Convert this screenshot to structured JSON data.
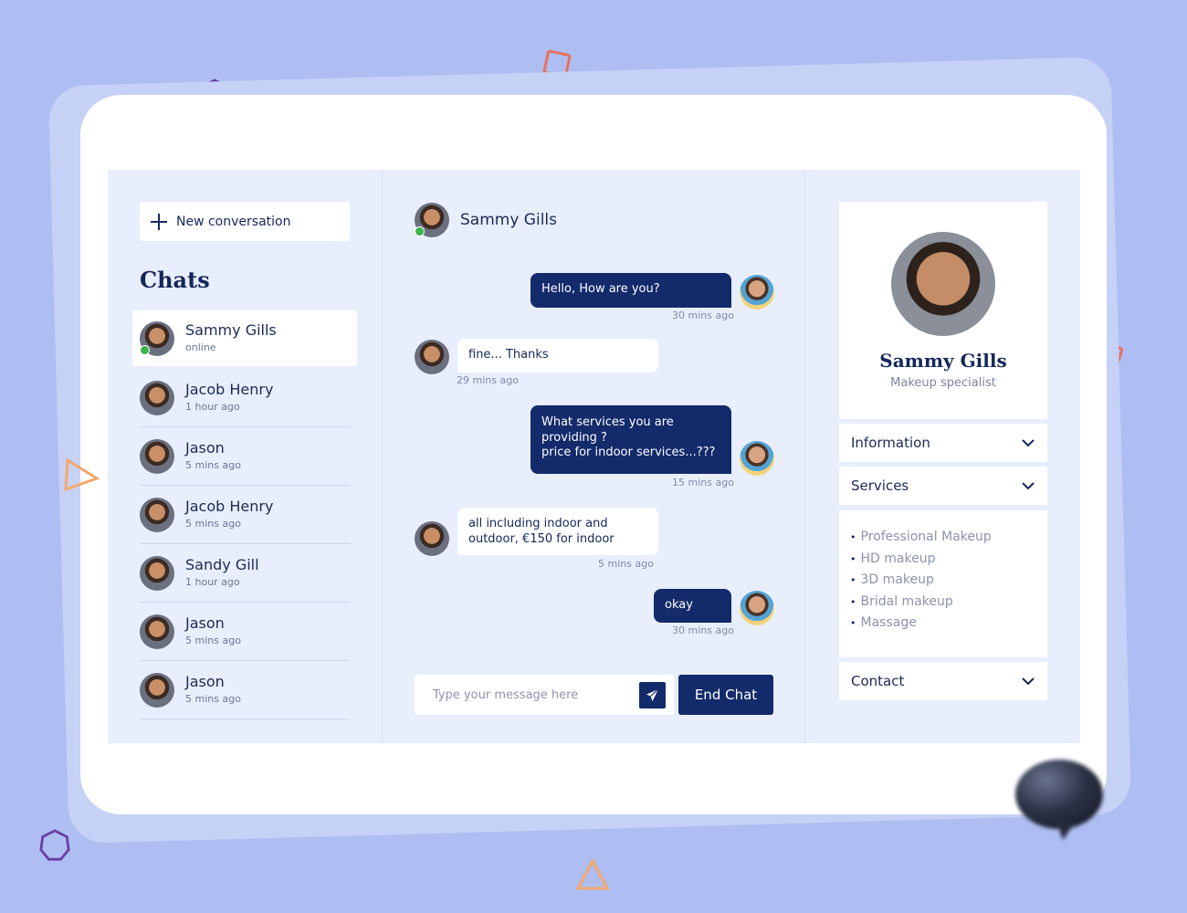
{
  "sidebar": {
    "new_conversation_label": "New conversation",
    "chats_title": "Chats",
    "chats": [
      {
        "name": "Sammy Gills",
        "status": "online",
        "active": true
      },
      {
        "name": "Jacob Henry",
        "status": "1 hour ago"
      },
      {
        "name": "Jason",
        "status": "5 mins ago"
      },
      {
        "name": "Jacob Henry",
        "status": "5 mins ago"
      },
      {
        "name": "Sandy Gill",
        "status": "1 hour ago"
      },
      {
        "name": "Jason",
        "status": "5 mins ago"
      },
      {
        "name": "Jason",
        "status": "5 mins ago"
      }
    ]
  },
  "chat": {
    "contact_name": "Sammy Gills",
    "messages": [
      {
        "direction": "out",
        "text": "Hello, How are you?",
        "time": "30 mins ago"
      },
      {
        "direction": "in",
        "text": "fine... Thanks",
        "time": "29 mins ago"
      },
      {
        "direction": "out",
        "text": "What services you are providing ?\nprice for indoor services...???",
        "time": "15 mins ago"
      },
      {
        "direction": "in",
        "text": "all including indoor and outdoor, €150 for indoor",
        "time": "5 mins ago"
      },
      {
        "direction": "out",
        "text": "okay",
        "time": "30 mins ago"
      }
    ],
    "composer_placeholder": "Type your message here",
    "end_chat_label": "End Chat"
  },
  "profile": {
    "name": "Sammy Gills",
    "role": "Makeup specialist",
    "sections": {
      "information": "Information",
      "services": "Services",
      "contact": "Contact"
    },
    "services": [
      "Professional Makeup",
      "HD makeup",
      "3D makeup",
      "Bridal makeup",
      "Massage"
    ]
  },
  "colors": {
    "background": "#aebef2",
    "accent": "#132a6b",
    "panel": "#e9eefd",
    "online": "#3cb54a"
  },
  "icons": [
    "plus-icon",
    "send-icon",
    "chevron-down-icon",
    "chat-bubble-icon"
  ]
}
